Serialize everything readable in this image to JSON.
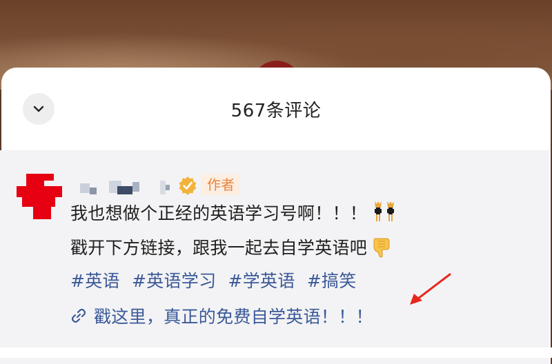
{
  "sheet": {
    "title": "567条评论",
    "collapse_icon": "chevron-down-icon"
  },
  "comment": {
    "badge": "作者",
    "line1": "我也想做个正经的英语学习号啊！！！",
    "line2": "戳开下方链接，跟我一起去自学英语吧",
    "tags": [
      "#英语",
      "#英语学习",
      "#学英语",
      "#搞笑"
    ],
    "link_text": "戳这里，真正的免费自学英语！！！",
    "verified_icon": "verified-badge-icon",
    "link_icon": "link-icon",
    "emoji_1": "dancing-cats-emoji",
    "emoji_2": "pointing-down-emoji"
  },
  "colors": {
    "tag_blue": "#3b5998",
    "badge_orange": "#e8863f",
    "avatar_red": "#e60012",
    "annotation_red": "#e8261c"
  }
}
